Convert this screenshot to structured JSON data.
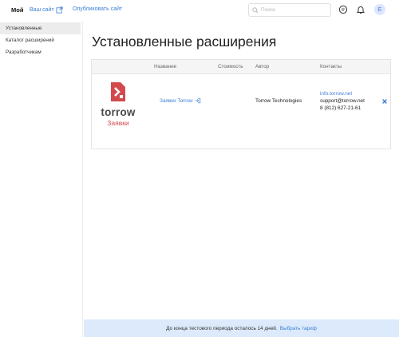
{
  "topbar": {
    "brand": "Мой",
    "site_link": "Ваш сайт",
    "publish_link": "Опубликовать сайт",
    "search_placeholder": "Поиск",
    "avatar_letter": "E"
  },
  "sidebar": {
    "items": [
      {
        "label": "Установленные",
        "active": true
      },
      {
        "label": "Каталог расширений",
        "active": false
      },
      {
        "label": "Разработчикам",
        "active": false
      }
    ]
  },
  "main": {
    "title": "Установленные расширения",
    "table": {
      "headers": [
        "Название",
        "Стоимость",
        "Автор",
        "Контакты"
      ],
      "rows": [
        {
          "logo_word": "torrow",
          "logo_sub": "Заявки",
          "name": "Заявки Torrow",
          "cost": "",
          "author": "Torrow Technologies",
          "contact_site": "info.torrow.net",
          "contact_email": "support@torrow.net",
          "contact_phone": "8 (812) 627-21-61"
        }
      ]
    }
  },
  "footer": {
    "text": "До конца тестового периода осталось 14 дней.",
    "link": "Выбрать тариф"
  },
  "colors": {
    "accent": "#3f7fd8",
    "logo_red": "#d24a4d",
    "footer_bg": "#dceafb",
    "active_item_bg": "#ececec"
  },
  "icons": [
    "external-link-icon",
    "search-icon",
    "chat-icon",
    "bell-icon",
    "login-icon",
    "close-icon",
    "logo-icon"
  ]
}
